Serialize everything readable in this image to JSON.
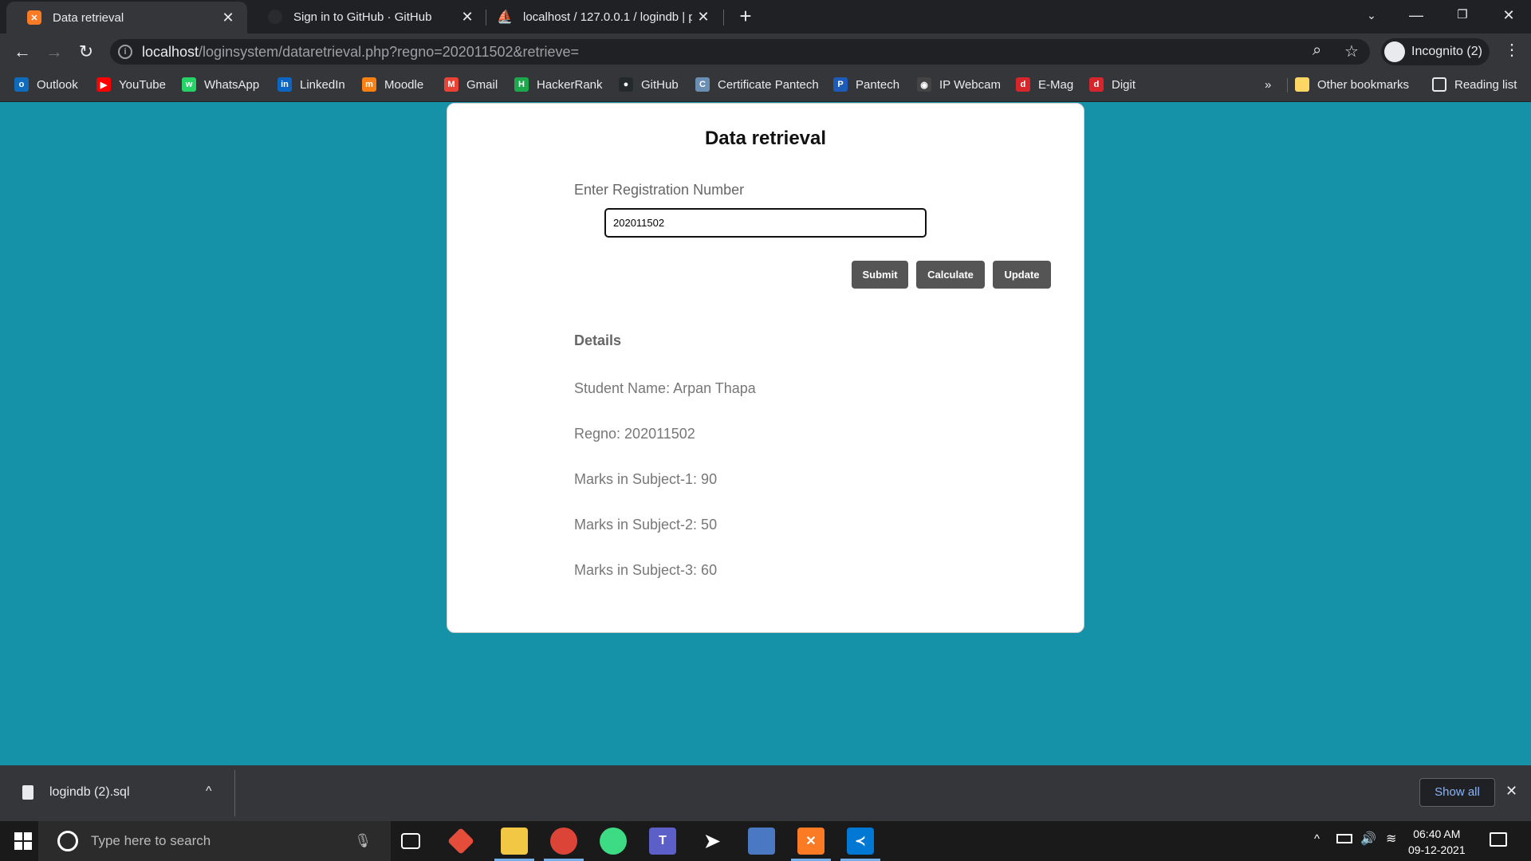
{
  "tabs": [
    {
      "title": "Data retrieval",
      "icon": "xampp-icon"
    },
    {
      "title": "Sign in to GitHub · GitHub",
      "icon": "github-icon"
    },
    {
      "title": "localhost / 127.0.0.1 / logindb | p",
      "icon": "phpmyadmin-icon"
    }
  ],
  "address": {
    "host": "localhost",
    "path": "/loginsystem/dataretrieval.php?regno=202011502&retrieve="
  },
  "profile": {
    "label": "Incognito (2)"
  },
  "bookmarks": [
    {
      "label": "Outlook",
      "color": "#0f6cbd",
      "glyph": "o"
    },
    {
      "label": "YouTube",
      "color": "#ff0000",
      "glyph": "▶"
    },
    {
      "label": "WhatsApp",
      "color": "#25d366",
      "glyph": "w"
    },
    {
      "label": "LinkedIn",
      "color": "#0a66c2",
      "glyph": "in"
    },
    {
      "label": "Moodle",
      "color": "#f98012",
      "glyph": "m"
    },
    {
      "label": "Gmail",
      "color": "#ea4335",
      "glyph": "M"
    },
    {
      "label": "HackerRank",
      "color": "#1ba94c",
      "glyph": "H"
    },
    {
      "label": "GitHub",
      "color": "#24292e",
      "glyph": "●"
    },
    {
      "label": "Certificate Pantech",
      "color": "#6b8fb3",
      "glyph": "C"
    },
    {
      "label": "Pantech",
      "color": "#1e5bb8",
      "glyph": "P"
    },
    {
      "label": "IP Webcam",
      "color": "#444444",
      "glyph": "◉"
    },
    {
      "label": "E-Mag",
      "color": "#d7262b",
      "glyph": "d"
    },
    {
      "label": "Digit",
      "color": "#d7262b",
      "glyph": "d"
    }
  ],
  "bookmarks_more": "»",
  "other_bookmarks": "Other bookmarks",
  "reading_list": "Reading list",
  "page": {
    "heading": "Data retrieval",
    "reg_label": "Enter Registration Number",
    "reg_value": "202011502",
    "buttons": {
      "submit": "Submit",
      "calculate": "Calculate",
      "update": "Update"
    },
    "details_title": "Details",
    "details": [
      "Student Name: Arpan Thapa",
      "Regno: 202011502",
      "Marks in Subject-1: 90",
      "Marks in Subject-2: 50",
      "Marks in Subject-3: 60"
    ]
  },
  "downloads": {
    "file": "logindb (2).sql",
    "show_all": "Show all"
  },
  "taskbar": {
    "search_placeholder": "Type here to search",
    "time": "06:40 AM",
    "date": "09-12-2021"
  },
  "colors": {
    "page_bg": "#1591a8",
    "button_bg": "#555555"
  }
}
